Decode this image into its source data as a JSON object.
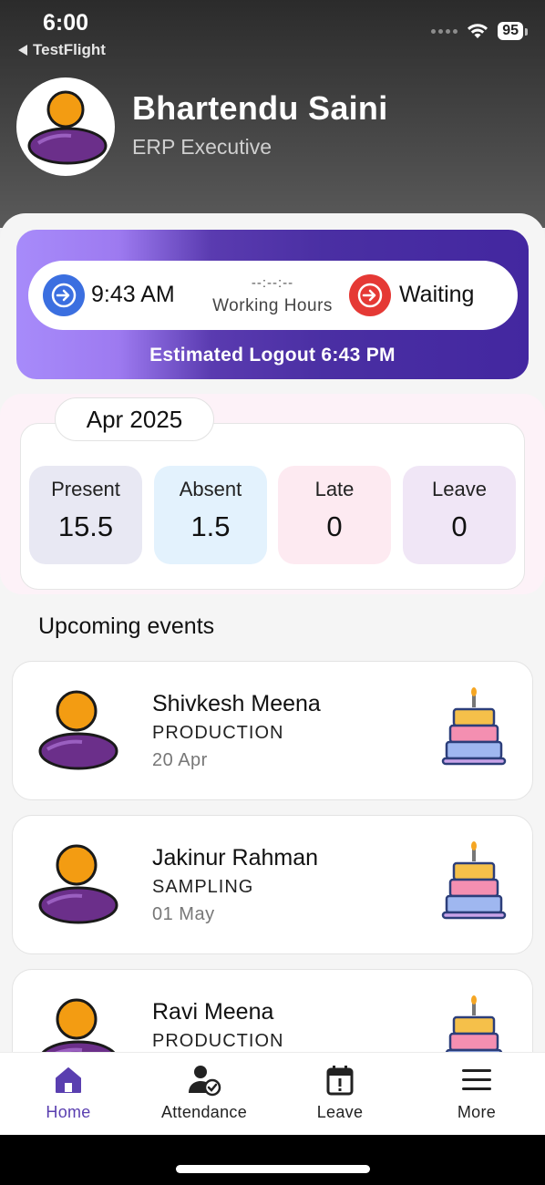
{
  "status_bar": {
    "time": "6:00",
    "back_app": "TestFlight",
    "battery": "95"
  },
  "profile": {
    "name": "Bhartendu Saini",
    "role": "ERP Executive"
  },
  "punch": {
    "in_time": "9:43 AM",
    "working_hours_value": "--:--:--",
    "working_hours_label": "Working Hours",
    "out_status": "Waiting",
    "estimated_logout": "Estimated Logout 6:43 PM",
    "colors": {
      "in": "#3b6fe0",
      "out": "#e53935",
      "card": "#4a2fa3"
    }
  },
  "summary": {
    "month": "Apr 2025",
    "stats": [
      {
        "label": "Present",
        "value": "15.5"
      },
      {
        "label": "Absent",
        "value": "1.5"
      },
      {
        "label": "Late",
        "value": "0"
      },
      {
        "label": "Leave",
        "value": "0"
      }
    ]
  },
  "events": {
    "title": "Upcoming events",
    "items": [
      {
        "name": "Shivkesh Meena",
        "department": "PRODUCTION",
        "date": "20 Apr",
        "icon": "birthday-cake-icon"
      },
      {
        "name": "Jakinur Rahman",
        "department": "SAMPLING",
        "date": "01 May",
        "icon": "birthday-cake-icon"
      },
      {
        "name": "Ravi Meena",
        "department": "PRODUCTION",
        "date": "",
        "icon": "birthday-cake-icon"
      }
    ]
  },
  "nav": {
    "items": [
      {
        "label": "Home",
        "icon": "home-icon",
        "active": true
      },
      {
        "label": "Attendance",
        "icon": "attendance-icon"
      },
      {
        "label": "Leave",
        "icon": "calendar-alert-icon"
      },
      {
        "label": "More",
        "icon": "menu-icon"
      }
    ],
    "active_color": "#5a3fb0"
  }
}
